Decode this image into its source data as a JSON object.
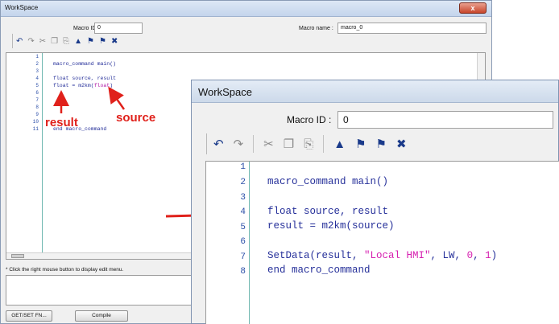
{
  "back_window": {
    "title": "WorkSpace",
    "close_label": "x",
    "macro_id_label": "Macro ID :",
    "macro_id_value": "0",
    "macro_name_label": "Macro name :",
    "macro_name_value": "macro_0",
    "line_numbers": [
      "1",
      "2",
      "3",
      "4",
      "5",
      "6",
      "7",
      "8",
      "9",
      "10",
      "11"
    ],
    "code": {
      "line2": "macro_command main()",
      "line4": "float source, result",
      "line5_a": "float = m2km(",
      "line5_b": "float",
      "line5_c": ")",
      "line11": "end macro_command"
    },
    "hint": "* Click the right mouse button to display edit menu.",
    "getset_button": "GET/SET FN...",
    "compile_button": "Compile"
  },
  "annotations": {
    "result": "result",
    "source": "source"
  },
  "front_window": {
    "title": "WorkSpace",
    "macro_id_label": "Macro ID :",
    "macro_id_value": "0",
    "line_numbers": [
      "1",
      "2",
      "3",
      "4",
      "5",
      "6",
      "7",
      "8"
    ],
    "code": {
      "line2": "macro_command main()",
      "line4": "float source, result",
      "line5": "result = m2km(source)",
      "line7_a": "SetData(result, ",
      "line7_str": "\"Local HMI\"",
      "line7_b": ", LW, ",
      "line7_n0": "0",
      "line7_c": ", ",
      "line7_n1": "1",
      "line7_d": ")",
      "line8": "end macro_command"
    }
  },
  "colors": {
    "annotation": "#e0211b",
    "code_text": "#26309a",
    "code_string": "#d61fb0",
    "gutter_line": "#6fb7b0"
  },
  "icons": [
    "undo-icon",
    "redo-icon",
    "cut-icon",
    "copy-icon",
    "paste-icon",
    "insert-icon",
    "search-icon",
    "search-next-icon",
    "delete-icon"
  ]
}
